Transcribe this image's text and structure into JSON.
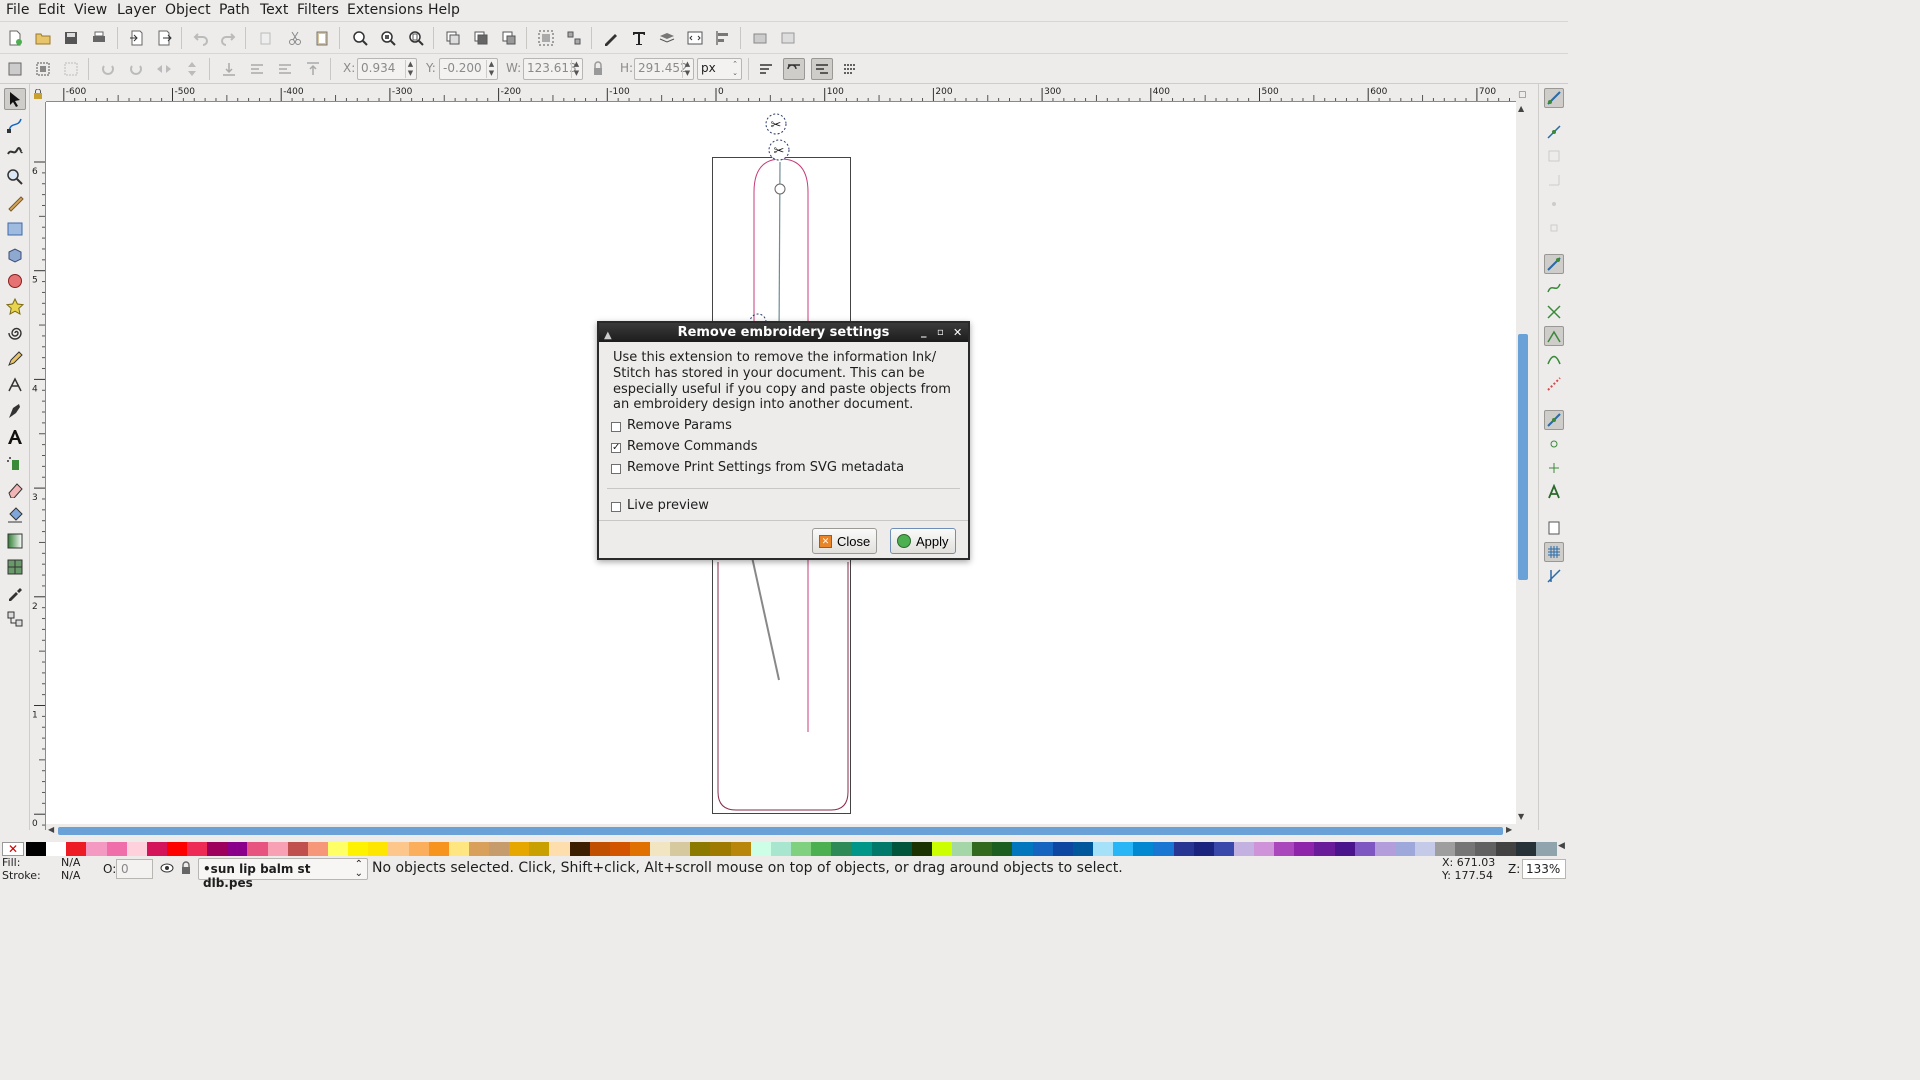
{
  "menubar": {
    "items": [
      {
        "label": "File"
      },
      {
        "label": "Edit"
      },
      {
        "label": "View"
      },
      {
        "label": "Layer"
      },
      {
        "label": "Object"
      },
      {
        "label": "Path"
      },
      {
        "label": "Text"
      },
      {
        "label": "Filters"
      },
      {
        "label": "Extensions"
      },
      {
        "label": "Help"
      }
    ]
  },
  "controls": {
    "x_label": "X:",
    "x_value": "0.934",
    "y_label": "Y:",
    "y_value": "-0.200",
    "w_label": "W:",
    "w_value": "123.613",
    "h_label": "H:",
    "h_value": "291.452",
    "unit": "px"
  },
  "ruler": {
    "h_ticks": [
      "-600",
      "-500",
      "-400",
      "-300",
      "-200",
      "-100",
      "0",
      "100",
      "200",
      "300",
      "400",
      "500",
      "600",
      "700"
    ],
    "v_ticks": [
      "6",
      "5",
      "4",
      "3",
      "2",
      "1",
      "0"
    ]
  },
  "dialog": {
    "title": "Remove embroidery settings",
    "description": "Use this extension to remove the information Ink/ Stitch has stored in your document. This can be especially useful if you copy and paste objects from an embroidery design into another document.",
    "options": [
      {
        "label": "Remove Params",
        "checked": false
      },
      {
        "label": "Remove Commands",
        "checked": true
      },
      {
        "label": "Remove Print Settings from SVG metadata",
        "checked": false
      }
    ],
    "live_preview": {
      "label": "Live preview",
      "checked": false
    },
    "close_label": "Close",
    "apply_label": "Apply"
  },
  "status": {
    "fill_label": "Fill:",
    "fill_value": "N/A",
    "stroke_label": "Stroke:",
    "stroke_value": "N/A",
    "opacity_label": "O:",
    "opacity_value": "0",
    "layer": "•sun lip balm st dlb.pes",
    "message": "No objects selected. Click, Shift+click, Alt+scroll mouse on top of objects, or drag around objects to select.",
    "x_coord": "X: 671.03",
    "y_coord": "Y: 177.54",
    "zoom_label": "Z:",
    "zoom_value": "133%"
  },
  "palette": [
    "#000000",
    "#ffffff",
    "#ed1c24",
    "#f49ac2",
    "#f06eaa",
    "#ffd1dc",
    "#d4145a",
    "#ff0000",
    "#ee2b55",
    "#9e005d",
    "#8b008b",
    "#e75480",
    "#f9a1b4",
    "#c0504d",
    "#f7977a",
    "#ffff66",
    "#fff200",
    "#ffe600",
    "#fdc68a",
    "#fbaf5d",
    "#f7941d",
    "#ffe680",
    "#d9a05b",
    "#c69c6d",
    "#e6a800",
    "#c8a000",
    "#ffdead",
    "#3b1f00",
    "#c05000",
    "#d35400",
    "#e07000",
    "#f2e6c2",
    "#d6c9a0",
    "#8c7a00",
    "#9e7b00",
    "#b8860b",
    "#ccffe6",
    "#a8e6cf",
    "#7fd17f",
    "#4caf50",
    "#2e8b57",
    "#009688",
    "#00796b",
    "#00553a",
    "#1a3300",
    "#ccff00",
    "#a5d6a7",
    "#33691e",
    "#1b5e20",
    "#0277bd",
    "#1565c0",
    "#0d47a1",
    "#01579b",
    "#a6e1fa",
    "#29b6f6",
    "#0288d1",
    "#1976d2",
    "#283593",
    "#1a237e",
    "#3949ab",
    "#c3b1e1",
    "#ce93d8",
    "#ab47bc",
    "#8e24aa",
    "#6a1b9a",
    "#4a148c",
    "#7e57c2",
    "#b39ddb",
    "#9fa8da",
    "#c5cae9",
    "#9e9e9e",
    "#757575",
    "#616161",
    "#424242",
    "#263238",
    "#90a4ae"
  ]
}
